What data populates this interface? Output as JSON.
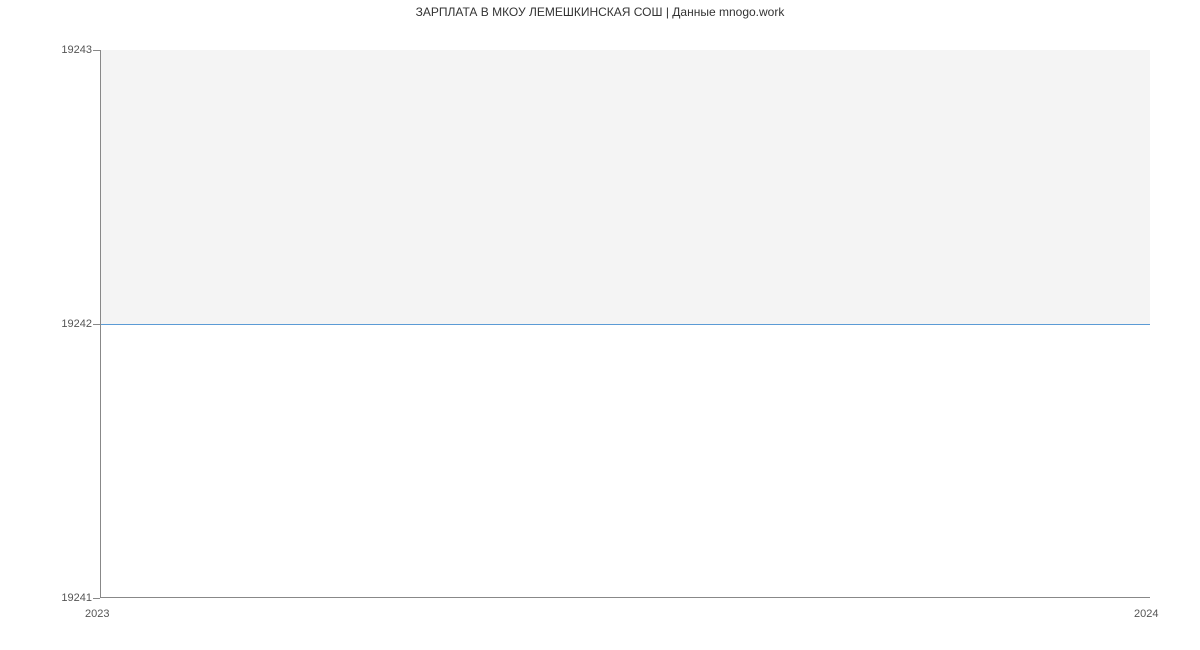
{
  "chart_data": {
    "type": "line",
    "title": "ЗАРПЛАТА В МКОУ ЛЕМЕШКИНСКАЯ СОШ | Данные mnogo.work",
    "x": [
      "2023",
      "2024"
    ],
    "values": [
      19242,
      19242
    ],
    "xlabel": "",
    "ylabel": "",
    "ylim": [
      19241,
      19243
    ],
    "y_ticks": [
      19241,
      19242,
      19243
    ],
    "x_ticks": [
      "2023",
      "2024"
    ]
  }
}
